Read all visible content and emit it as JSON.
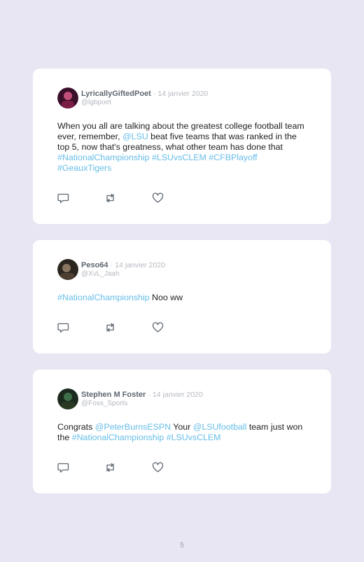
{
  "tweets": [
    {
      "name": "LyricallyGiftedPoet",
      "dot": "·",
      "date": "14 janvier 2020",
      "handle": "@lgbpoet",
      "text": {
        "p1": "When you all are talking about the greatest college football team ever, remember, ",
        "m1": "@LSU",
        "p2": " beat five teams that was ranked in the top 5, now that's greatness, what other team has done that ",
        "h1": "#NationalChampionship",
        "sp1": " ",
        "h2": "#LSUvsCLEM",
        "sp2": " ",
        "h3": "#CFBPlayoff",
        "sp3": " ",
        "h4": "#GeauxTigers"
      },
      "avatar_colors": [
        "#3a0f2a",
        "#c0507a"
      ]
    },
    {
      "name": "Peso64",
      "dot": "·",
      "date": "14 janvier 2020",
      "handle": "@XvL_Jaah",
      "text": {
        "h1": "#NationalChampionship",
        "p1": " Noo ww"
      },
      "avatar_colors": [
        "#2b2620",
        "#8a7560"
      ]
    },
    {
      "name": "Stephen M Foster",
      "dot": "·",
      "date": "14 janvier 2020",
      "handle": "@Foss_Sports",
      "text": {
        "p1": "Congrats ",
        "m1": "@PeterBurnsESPN",
        "p2": " Your ",
        "m2": "@LSUfootball",
        "p3": " team just won the ",
        "h1": "#NationalChampionship",
        "sp1": " ",
        "h2": "#LSUvsCLEM"
      },
      "avatar_colors": [
        "#1c2a1e",
        "#3f6f4a"
      ]
    }
  ],
  "icons": {
    "reply": "reply-icon",
    "retweet": "retweet-icon",
    "like": "heart-icon"
  },
  "colors": {
    "background": "#e9e6f3",
    "card": "#ffffff",
    "link": "#66bde8",
    "muted": "#b4b8bf",
    "name": "#5f6771",
    "icon": "#5f6771"
  },
  "page_number": "5"
}
